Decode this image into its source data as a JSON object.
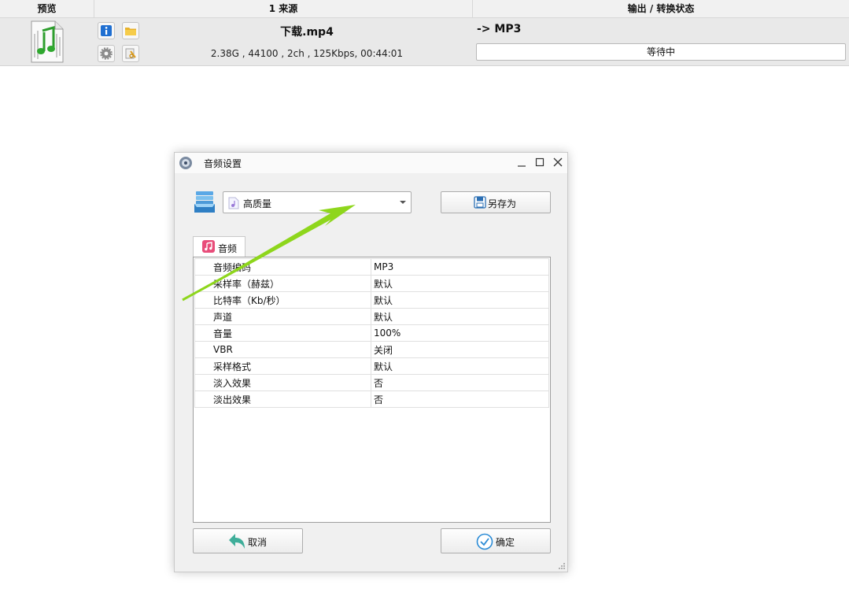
{
  "table": {
    "headers": {
      "preview": "预览",
      "source": "1 来源",
      "output": "输出 / 转换状态"
    },
    "row": {
      "filename": "下载.mp4",
      "meta": "2.38G , 44100 , 2ch , 125Kbps, 00:44:01",
      "target": "-> MP3",
      "status": "等待中"
    }
  },
  "dialog": {
    "title": "音频设置",
    "preset": {
      "selected": "高质量"
    },
    "save_as_label": "另存为",
    "tab_label": "音频",
    "properties": [
      {
        "key": "音频编码",
        "value": "MP3"
      },
      {
        "key": "采样率（赫兹）",
        "value": "默认"
      },
      {
        "key": "比特率（Kb/秒）",
        "value": "默认"
      },
      {
        "key": "声道",
        "value": "默认"
      },
      {
        "key": "音量",
        "value": "100%"
      },
      {
        "key": "VBR",
        "value": "关闭"
      },
      {
        "key": "采样格式",
        "value": "默认"
      },
      {
        "key": "淡入效果",
        "value": "否"
      },
      {
        "key": "淡出效果",
        "value": "否"
      }
    ],
    "cancel_label": "取消",
    "ok_label": "确定"
  },
  "icons": {
    "thumbnail": "music-file-icon",
    "info": "info-icon",
    "folder": "folder-icon",
    "settings": "gear-icon",
    "clip": "clip-icon",
    "preset": "preset-stack-icon",
    "save": "floppy-disk-icon",
    "cancel": "undo-arrow-icon",
    "ok": "check-circle-icon",
    "annotation": "green-arrow"
  },
  "colors": {
    "accent_green": "#8ed61c",
    "tab_music_pink": "#e84d7a",
    "ok_blue": "#2a8bd6",
    "cancel_teal": "#3fae9a"
  }
}
